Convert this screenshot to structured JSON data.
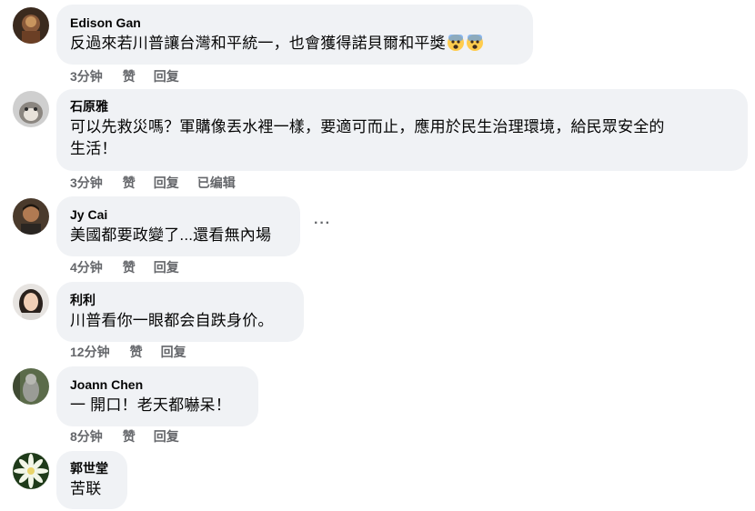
{
  "comments": [
    {
      "author": "Edison Gan",
      "text": "反過來若川普讓台灣和平統一，也會獲得諾貝爾和平獎",
      "emojis": [
        "fearful-face-icon",
        "fearful-face-icon"
      ],
      "time": "3分钟",
      "like": "赞",
      "reply": "回复"
    },
    {
      "author": "石原雅",
      "text_line1": "可以先救災嗎？軍購像丟水裡一樣，要適可而止，應用於民生治理環境，給民眾安全的",
      "text_line2": "生活！",
      "time": "3分钟",
      "like": "赞",
      "reply": "回复",
      "edited": "已编辑"
    },
    {
      "author": "Jy Cai",
      "text": "美國都要政變了...還看無內場",
      "more": "···",
      "time": "4分钟",
      "like": "赞",
      "reply": "回复"
    },
    {
      "author": "利利",
      "text": "川普看你一眼都会自跌身价。",
      "time": "12分钟",
      "like": "赞",
      "reply": "回复"
    },
    {
      "author": "Joann Chen",
      "text": "一 開口！老天都嚇呆！",
      "time": "8分钟",
      "like": "赞",
      "reply": "回复"
    },
    {
      "author": "郭世堂",
      "text": "苦联"
    }
  ],
  "colors": {
    "bubble": "#f0f2f5",
    "text": "#050505",
    "meta": "#65676b"
  }
}
